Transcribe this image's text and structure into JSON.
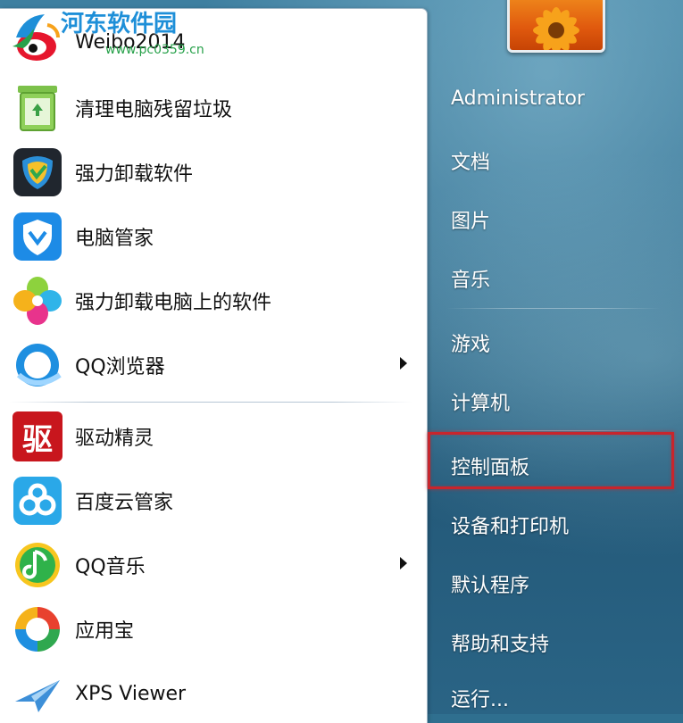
{
  "watermark": {
    "title": "河东软件园",
    "url": "www.pc0359.cn"
  },
  "programs": [
    {
      "label": "Weibo2014",
      "icon": "weibo-icon",
      "submenu": false
    },
    {
      "label": "清理电脑残留垃圾",
      "icon": "recycle-bin-icon",
      "submenu": false
    },
    {
      "label": "强力卸载软件",
      "icon": "uninstaller-icon",
      "submenu": false
    },
    {
      "label": "电脑管家",
      "icon": "pc-manager-shield-icon",
      "submenu": false
    },
    {
      "label": "强力卸载电脑上的软件",
      "icon": "colorful-petals-icon",
      "submenu": false
    },
    {
      "label": "QQ浏览器",
      "icon": "qq-browser-icon",
      "submenu": true
    },
    {
      "label": "驱动精灵",
      "icon": "driver-genius-icon",
      "submenu": false
    },
    {
      "label": "百度云管家",
      "icon": "baidu-cloud-icon",
      "submenu": false
    },
    {
      "label": "QQ音乐",
      "icon": "qq-music-icon",
      "submenu": true
    },
    {
      "label": "应用宝",
      "icon": "app-store-icon",
      "submenu": false
    },
    {
      "label": "XPS Viewer",
      "icon": "xps-viewer-icon",
      "submenu": false
    }
  ],
  "driver_icon_glyph": "驱",
  "right_menu": {
    "user": "Administrator",
    "documents": "文档",
    "pictures": "图片",
    "music": "音乐",
    "games": "游戏",
    "computer": "计算机",
    "control_panel": "控制面板",
    "devices_printers": "设备和打印机",
    "default_programs": "默认程序",
    "help_support": "帮助和支持",
    "run": "运行..."
  },
  "colors": {
    "highlight_border": "#c8252c",
    "watermark_blue": "#1e8fd8",
    "watermark_green": "#27a14a"
  }
}
